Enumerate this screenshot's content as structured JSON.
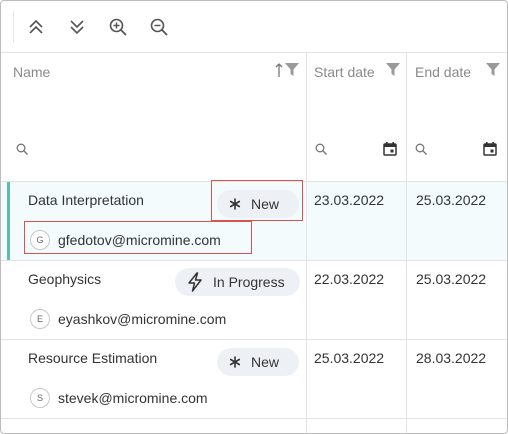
{
  "toolbar": {
    "buttons": [
      {
        "name": "collapse-all",
        "icon": "chevrons-up-icon"
      },
      {
        "name": "expand-all",
        "icon": "chevrons-down-icon"
      },
      {
        "name": "zoom-in",
        "icon": "zoom-in-icon"
      },
      {
        "name": "zoom-out",
        "icon": "zoom-out-icon"
      }
    ]
  },
  "columns": {
    "name": "Name",
    "start": "Start date",
    "end": "End date"
  },
  "rows": [
    {
      "name": "Data Interpretation",
      "status": "New",
      "status_icon": "asterisk-icon",
      "user_initial": "G",
      "user": "gfedotov@micromine.com",
      "start": "23.03.2022",
      "end": "25.03.2022"
    },
    {
      "name": "Geophysics",
      "status": "In Progress",
      "status_icon": "lightning-icon",
      "user_initial": "E",
      "user": "eyashkov@micromine.com",
      "start": "22.03.2022",
      "end": "25.03.2022"
    },
    {
      "name": "Resource Estimation",
      "status": "New",
      "status_icon": "asterisk-icon",
      "user_initial": "S",
      "user": "stevek@micromine.com",
      "start": "25.03.2022",
      "end": "28.03.2022"
    }
  ],
  "colors": {
    "selection_bar": "#5bbfb0",
    "highlight": "#d9534f",
    "chip_bg": "#edf1f6"
  }
}
